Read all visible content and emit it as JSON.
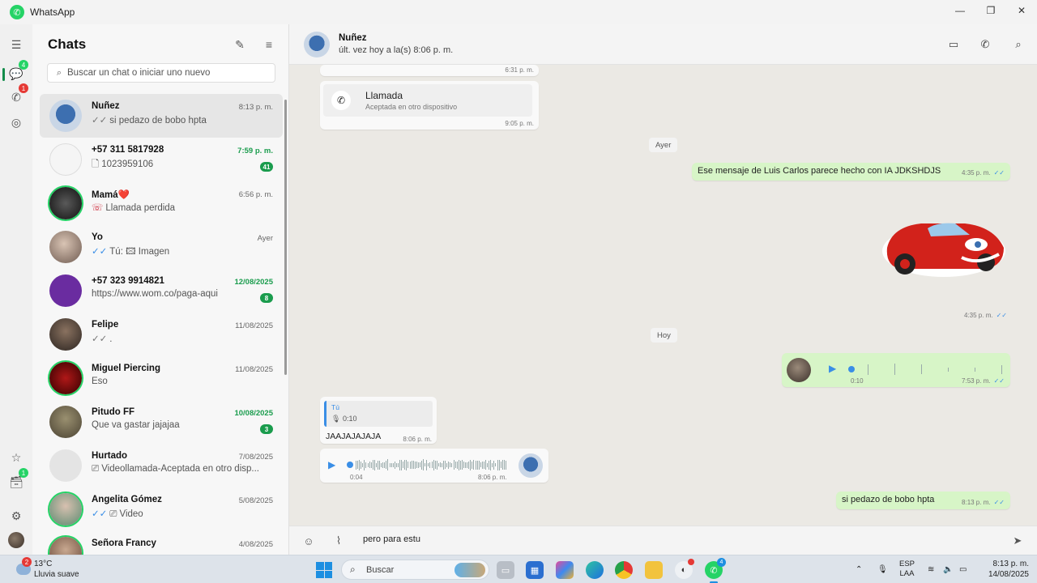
{
  "app": {
    "title": "WhatsApp"
  },
  "window_controls": {
    "minimize": "—",
    "maximize": "❐",
    "close": "✕"
  },
  "rail": {
    "chats_badge": "4",
    "calls_badge": "1",
    "archived_badge": "1"
  },
  "panel": {
    "title": "Chats",
    "search_placeholder": "Buscar un chat o iniciar uno nuevo"
  },
  "chats": [
    {
      "name": "Nuñez",
      "time": "8:13 p. m.",
      "preview": "si pedazo de bobo hpta",
      "tick": "✓✓"
    },
    {
      "name": "+57 311 5817928",
      "time": "7:59 p. m.",
      "preview": "1023959106",
      "unread": "41",
      "prefix": "🗋"
    },
    {
      "name": "Mamá❤️",
      "time": "6:56 p. m.",
      "preview": "Llamada perdida",
      "prefix": "☏"
    },
    {
      "name": "Yo",
      "time": "Ayer",
      "preview": "Tú: 🖾 Imagen",
      "tick": "✓✓"
    },
    {
      "name": "+57 323 9914821",
      "time": "12/08/2025",
      "preview": "https://www.wom.co/paga-aqui",
      "unread": "8"
    },
    {
      "name": "Felipe",
      "time": "11/08/2025",
      "preview": ".",
      "tick": "✓✓"
    },
    {
      "name": "Miguel Piercing",
      "time": "11/08/2025",
      "preview": "Eso"
    },
    {
      "name": "Pitudo FF",
      "time": "10/08/2025",
      "preview": "Que va gastar jajajaa",
      "unread": "3"
    },
    {
      "name": "Hurtado",
      "time": "7/08/2025",
      "preview": "Videollamada-Aceptada en otro disp...",
      "prefix": "⎚"
    },
    {
      "name": "Angelita Gómez",
      "time": "5/08/2025",
      "preview": "Video",
      "tick": "✓✓",
      "prefix": "⎚"
    },
    {
      "name": "Señora Francy",
      "time": "4/08/2025",
      "preview": ""
    }
  ],
  "conversation": {
    "name": "Nuñez",
    "status": "últ. vez hoy a la(s) 8:06 p. m.",
    "messages": {
      "top_time": "6:31 p. m.",
      "call_title": "Llamada",
      "call_sub": "Aceptada en otro dispositivo",
      "call_time": "9:05 p. m.",
      "day_ayer": "Ayer",
      "msg1_text": "Ese mensaje de Luis Carlos parece hecho con IA JDKSHDJS",
      "msg1_time": "4:35 p. m.",
      "sticker_time": "4:35 p. m.",
      "day_hoy": "Hoy",
      "audio_out_dur": "0:10",
      "audio_out_time": "7:53 p. m.",
      "reply_author": "Tú",
      "reply_dur": "0:10",
      "reply_text": "JAAJAJAJAJA",
      "reply_time": "8:06 p. m.",
      "audio_in_dur": "0:04",
      "audio_in_time": "8:06 p. m.",
      "last_text": "si pedazo de bobo hpta",
      "last_time": "8:13 p. m."
    },
    "composer_text": "pero para estu"
  },
  "taskbar": {
    "weather_badge": "2",
    "temperature": "13°C",
    "condition": "Lluvia suave",
    "search_label": "Buscar",
    "whatsapp_badge": "4",
    "lang_top": "ESP",
    "lang_bottom": "LAA",
    "time": "8:13 p. m.",
    "date": "14/08/2025"
  },
  "colors": {
    "accent_green": "#25d366",
    "unread_green": "#1a9c4d",
    "outgoing_bubble": "#d7f5c7",
    "read_tick_blue": "#3a8ee6",
    "badge_red": "#e53935"
  }
}
